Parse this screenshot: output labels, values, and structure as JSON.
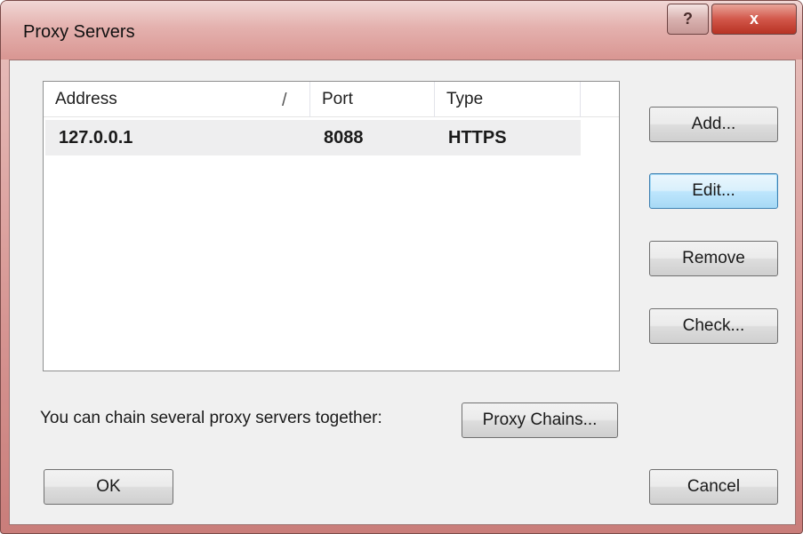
{
  "window": {
    "title": "Proxy Servers",
    "help_label": "?",
    "close_label": "x"
  },
  "list": {
    "columns": [
      "Address",
      "Port",
      "Type"
    ],
    "sort_indicator": "/",
    "rows": [
      {
        "address": "127.0.0.1",
        "port": "8088",
        "type": "HTTPS"
      }
    ]
  },
  "buttons": {
    "add": "Add...",
    "edit": "Edit...",
    "remove": "Remove",
    "check": "Check...",
    "proxy_chains": "Proxy Chains...",
    "ok": "OK",
    "cancel": "Cancel"
  },
  "hint": "You can chain several proxy servers together:",
  "colors": {
    "titlebar": "#e4b1ae",
    "close_button": "#d2574a",
    "focused_button": "#bee6fd",
    "selected_row": "#eeeeef"
  }
}
